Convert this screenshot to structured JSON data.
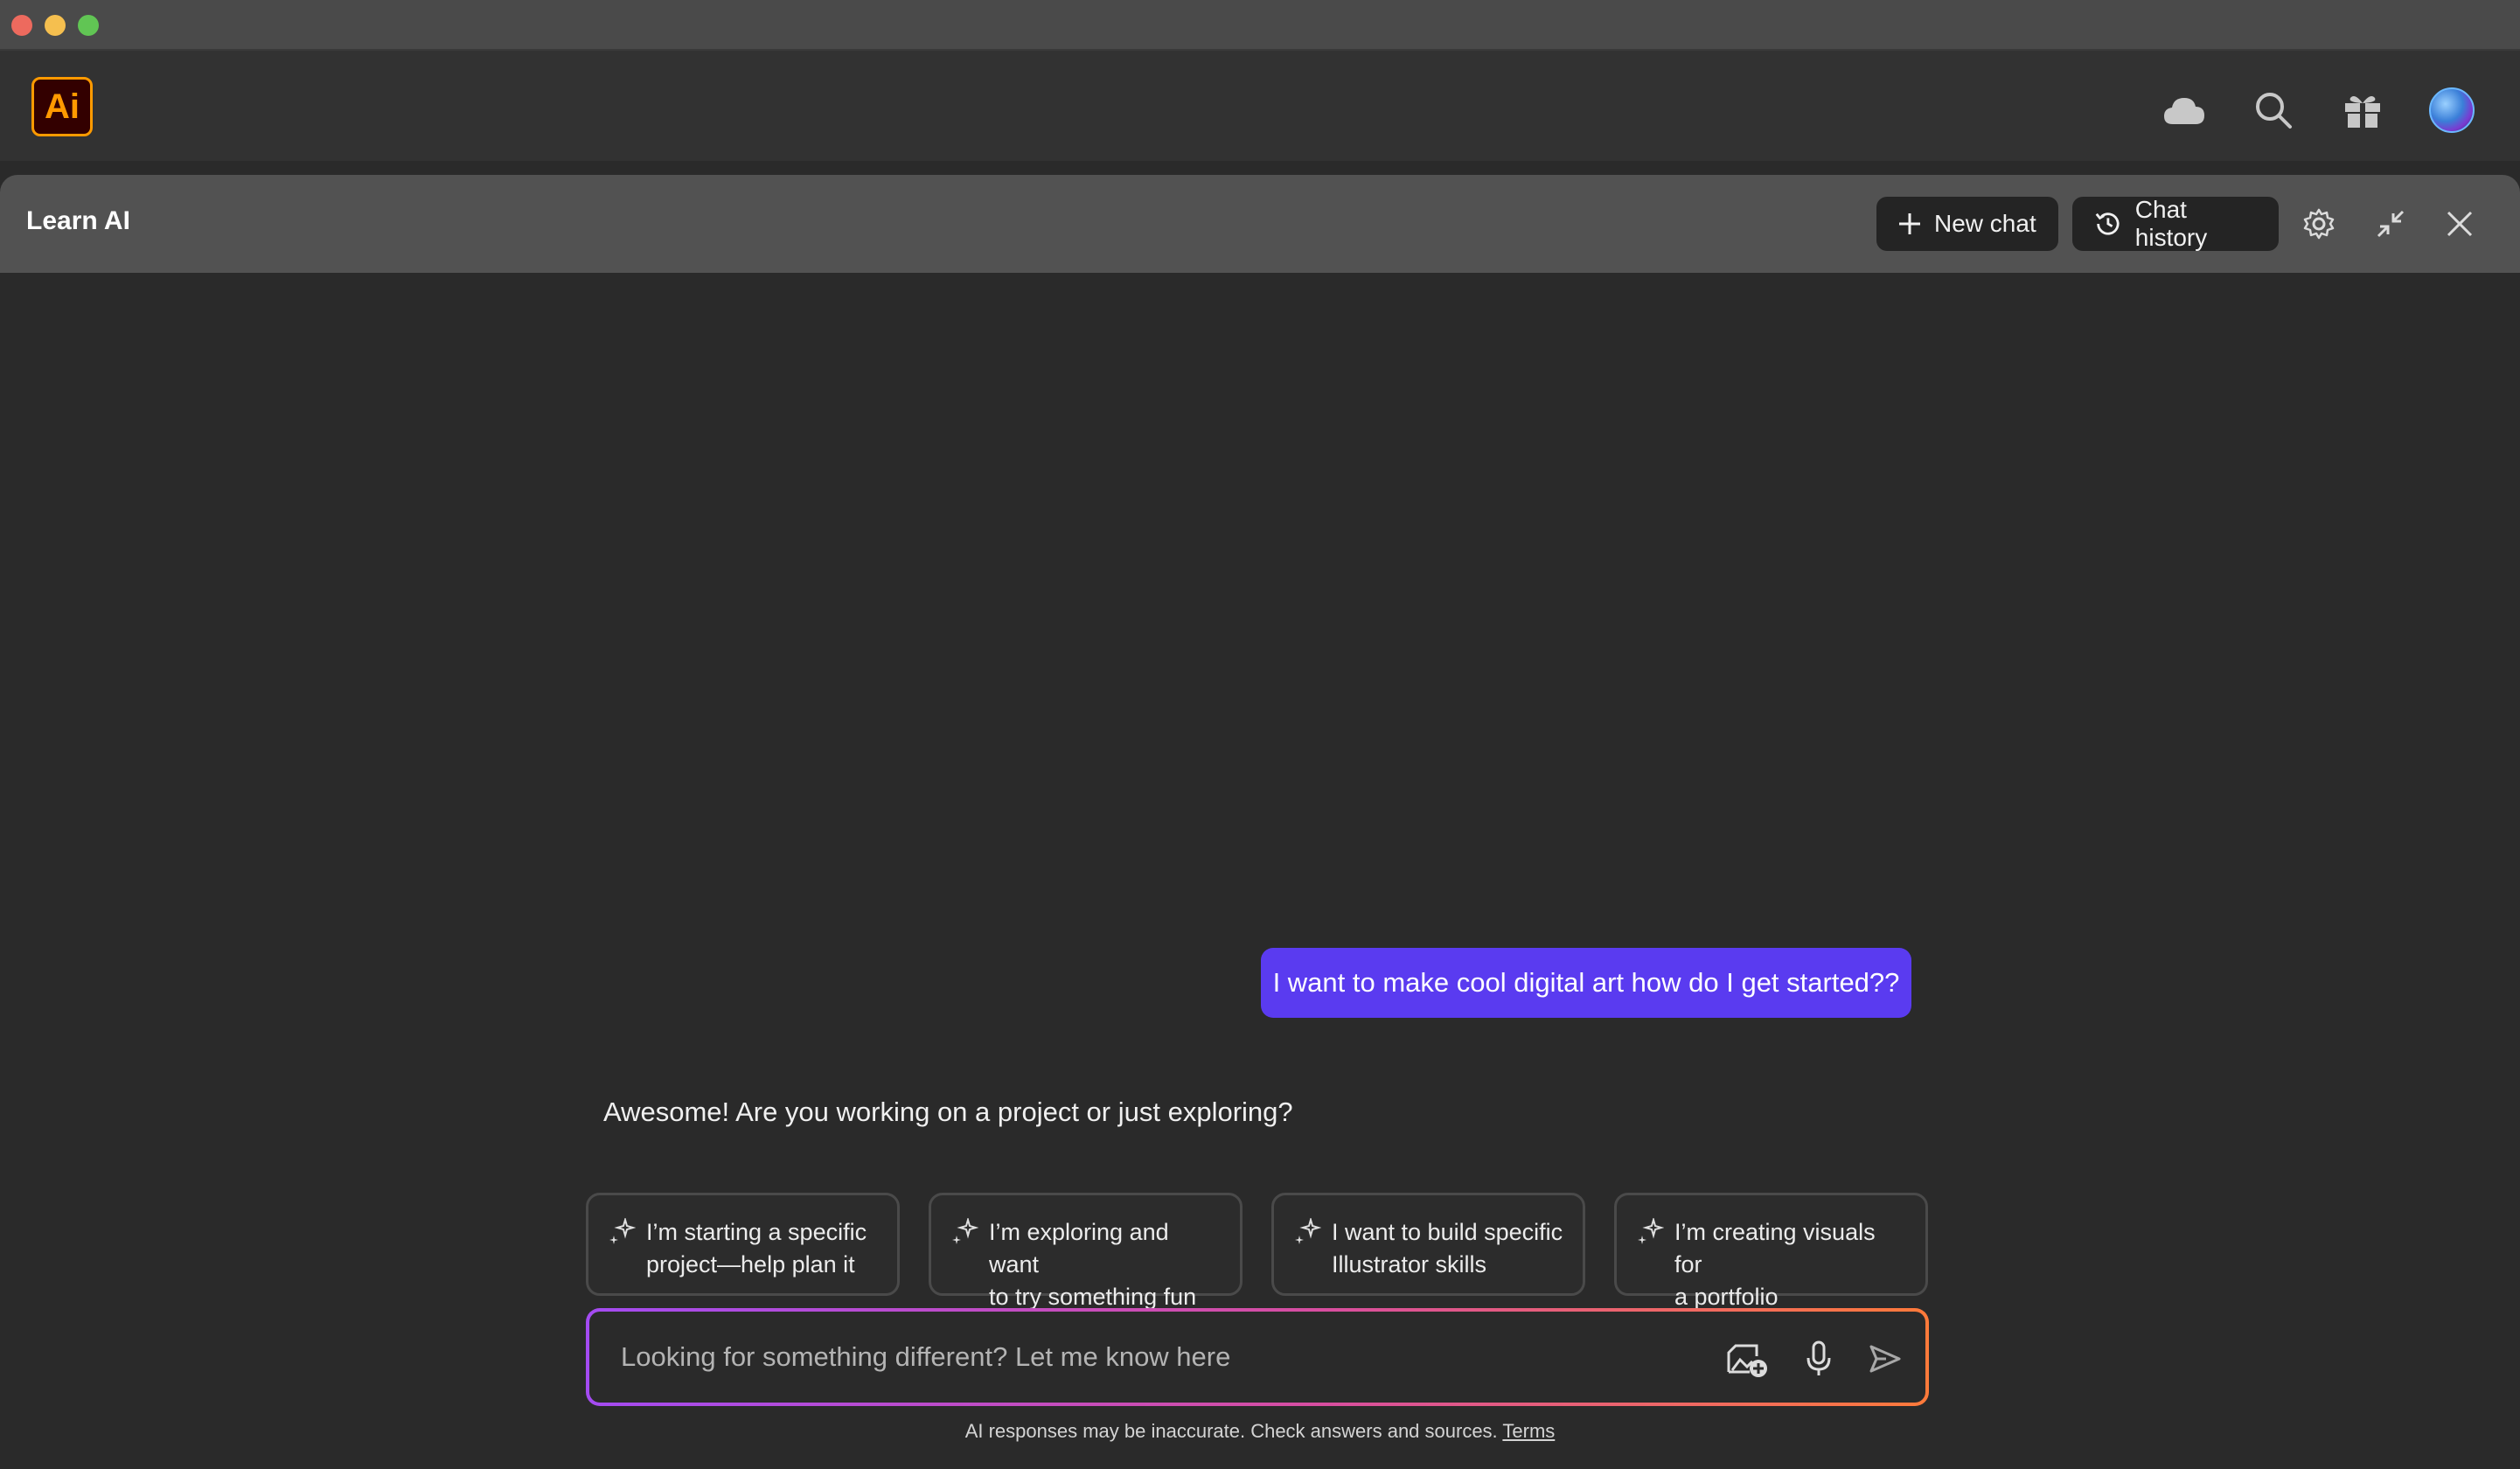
{
  "app": {
    "logo_text": "Ai",
    "brand_color": "#ff9a00"
  },
  "appbar": {
    "icons": [
      "cloud-icon",
      "search-icon",
      "gift-icon",
      "avatar"
    ]
  },
  "panel": {
    "title": "Learn AI",
    "new_chat_label": "New chat",
    "chat_history_label": "Chat history"
  },
  "conversation": {
    "user_message": "I want to make cool digital art how do I get started??",
    "assistant_message": "Awesome! Are you working on a project or just exploring?",
    "suggestions": [
      {
        "line1": "I’m starting a specific",
        "line2": "project—help plan it"
      },
      {
        "line1": "I’m exploring and want",
        "line2": "to try something fun"
      },
      {
        "line1": "I want to build specific",
        "line2": "Illustrator skills"
      },
      {
        "line1": "I’m creating visuals for",
        "line2": "a portfolio"
      }
    ]
  },
  "composer": {
    "placeholder": "Looking for something different? Let me know here",
    "value": ""
  },
  "footer": {
    "disclaimer": "AI responses may be inaccurate. Check answers and sources.",
    "terms_label": "Terms"
  },
  "colors": {
    "user_bubble": "#5a3bf0",
    "input_gradient_start": "#a44bf2",
    "input_gradient_end": "#ff7a3a"
  }
}
